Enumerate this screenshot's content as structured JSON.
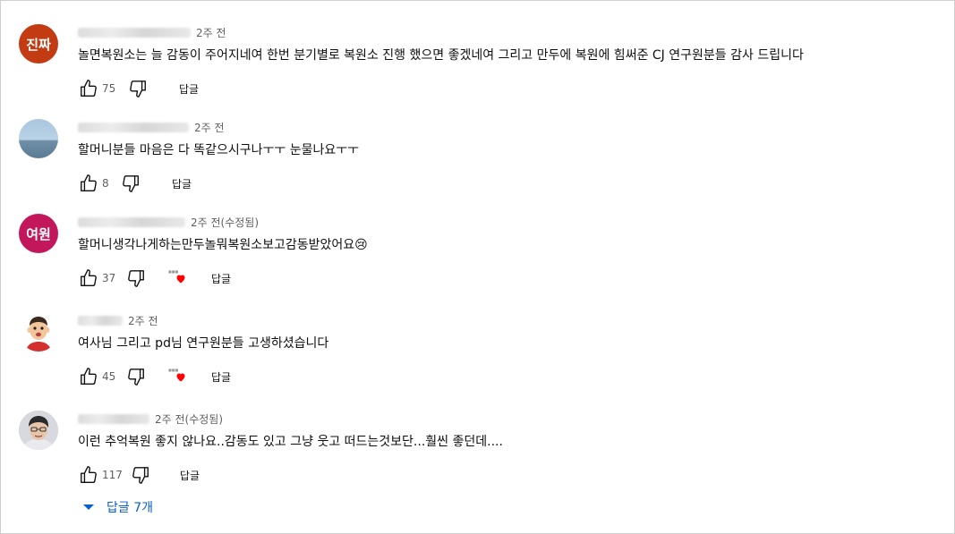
{
  "comments": [
    {
      "avatar_text": "진짜",
      "avatar_color": "#c23b13",
      "time": "2주 전",
      "text": "놀면복원소는 늘 감동이 주어지네여 한번 분기별로 복원소 진행 했으면 좋겠네여 그리고 만두에 복원에 힘써준 CJ 연구원분들 감사 드립니다",
      "likes": "75",
      "reply_label": "답글"
    },
    {
      "avatar_text": "",
      "avatar_color": "#9bb8cf",
      "time": "2주 전",
      "text": "할머니분들 마음은 다 똑같으시구나ㅜㅜ 눈물나요ㅜㅜ",
      "likes": "8",
      "reply_label": "답글"
    },
    {
      "avatar_text": "여원",
      "avatar_color": "#c2185b",
      "time": "2주 전(수정됨)",
      "text": "할머니생각나게하는만두놀뭐복원소보고감동받았어요😢",
      "likes": "37",
      "hearted": true,
      "reply_label": "답글"
    },
    {
      "avatar_text": "",
      "avatar_color": "#f3e0cf",
      "time": "2주 전",
      "text": "여사님 그리고 pd님 연구원분들 고생하셨습니다",
      "likes": "45",
      "hearted": true,
      "reply_label": "답글"
    },
    {
      "avatar_text": "",
      "avatar_color": "#b9bcc4",
      "time": "2주 전(수정됨)",
      "text": "이런 추억복원 좋지 않나요..감동도 있고 그냥 웃고 떠드는것보단...훨씬 좋던데....",
      "likes": "117",
      "reply_label": "답글"
    }
  ],
  "replies_toggle": "답글 7개",
  "colors": {
    "link_blue": "#065fd4",
    "heart_red": "#ff0000",
    "meta_gray": "#606060"
  }
}
